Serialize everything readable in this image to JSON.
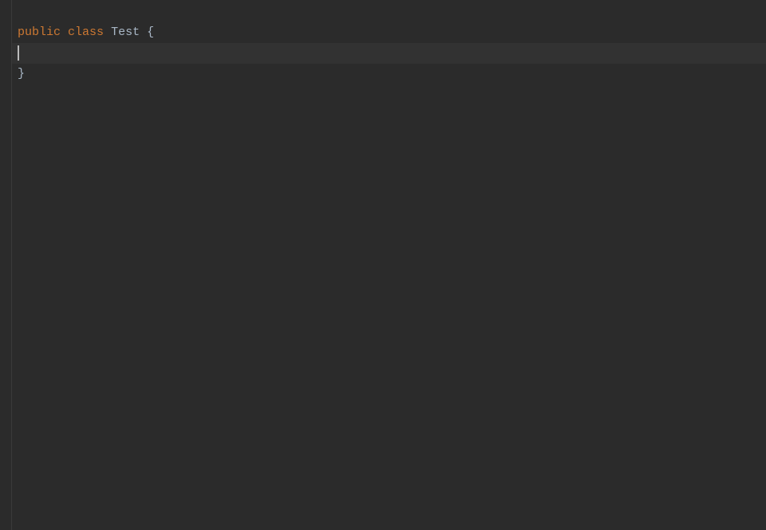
{
  "editor": {
    "lines": [
      {
        "tokens": [
          {
            "text": "public",
            "class": "keyword"
          },
          {
            "text": " ",
            "class": "plain"
          },
          {
            "text": "class",
            "class": "keyword"
          },
          {
            "text": " ",
            "class": "plain"
          },
          {
            "text": "Test",
            "class": "identifier"
          },
          {
            "text": " ",
            "class": "plain"
          },
          {
            "text": "{",
            "class": "brace"
          }
        ],
        "current": false
      },
      {
        "tokens": [],
        "current": true,
        "hasCursor": true
      },
      {
        "tokens": [
          {
            "text": "}",
            "class": "brace"
          }
        ],
        "current": false
      }
    ]
  },
  "colors": {
    "background": "#2b2b2b",
    "currentLine": "#323232",
    "keyword": "#cc7832",
    "text": "#a9b7c6",
    "cursor": "#bbbbbb",
    "gutterBorder": "#3a3a3a"
  }
}
